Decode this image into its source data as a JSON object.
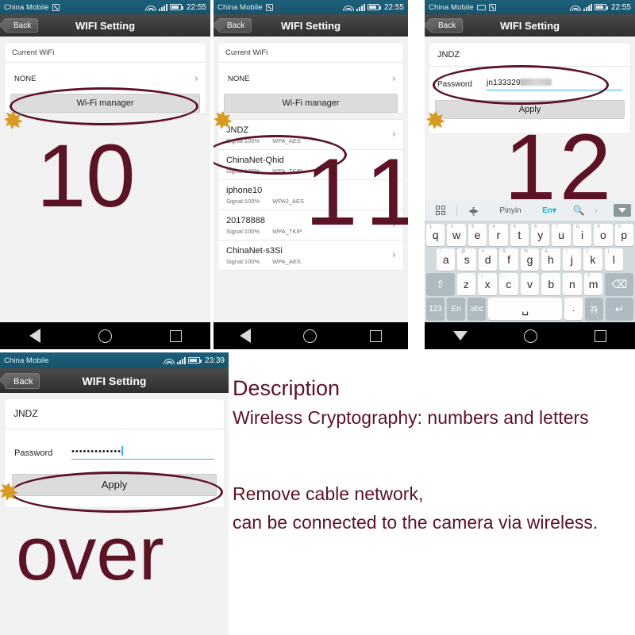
{
  "panels": {
    "p1": {
      "statusbar": {
        "carrier": "China Mobile",
        "time": "22:55",
        "icons": [
          "message-icon",
          "wifi-icon",
          "signal-icon",
          "battery-icon"
        ]
      },
      "titlebar": {
        "back": "Back",
        "title": "WIFI Setting"
      },
      "card": {
        "header": "Current WiFi",
        "value": "NONE",
        "chevron": "›",
        "button": "Wi-Fi manager"
      },
      "step": "10"
    },
    "p2": {
      "statusbar": {
        "carrier": "China Mobile",
        "time": "22:55"
      },
      "titlebar": {
        "back": "Back",
        "title": "WIFI Setting"
      },
      "card": {
        "header": "Current WiFi",
        "value": "NONE",
        "chevron": "›",
        "button": "Wi-Fi manager"
      },
      "networks": [
        {
          "ssid": "JNDZ",
          "signal": "Signal:100%",
          "security": "WPA_AES",
          "chevron": "›"
        },
        {
          "ssid": "ChinaNet-Qhid",
          "signal": "Signal:100%",
          "security": "WPA_TKIP",
          "chevron": "›"
        },
        {
          "ssid": "iphone10",
          "signal": "Signal:100%",
          "security": "WPA2_AES",
          "chevron": "›"
        },
        {
          "ssid": "20178888",
          "signal": "Signal:100%",
          "security": "WPA_TKIP",
          "chevron": "›"
        },
        {
          "ssid": "ChinaNet-s3Si",
          "signal": "Signal:100%",
          "security": "WPA_AES",
          "chevron": "›"
        }
      ],
      "step": "11"
    },
    "p3": {
      "statusbar": {
        "carrier": "China Mobile",
        "time": "22:55"
      },
      "titlebar": {
        "back": "Back",
        "title": "WIFI Setting"
      },
      "form": {
        "ssid": "JNDZ",
        "password_label": "Password",
        "password_value": "jn133329",
        "apply": "Apply"
      },
      "keyboard": {
        "toolbar": {
          "grid_icon": "grid-icon",
          "cursor_icon": "cursor-move-icon",
          "mode": "Pinyin",
          "lang": "En▾",
          "search_icon": "search-icon",
          "more": "›",
          "collapse_icon": "collapse-icon"
        },
        "row1": [
          {
            "k": "q",
            "n": "1"
          },
          {
            "k": "w",
            "n": "2"
          },
          {
            "k": "e",
            "n": "3"
          },
          {
            "k": "r",
            "n": "4"
          },
          {
            "k": "t",
            "n": "5"
          },
          {
            "k": "y",
            "n": "6"
          },
          {
            "k": "u",
            "n": "7"
          },
          {
            "k": "i",
            "n": "8"
          },
          {
            "k": "o",
            "n": "9"
          },
          {
            "k": "p",
            "n": "0"
          }
        ],
        "row2": [
          {
            "k": "a",
            "n": "!"
          },
          {
            "k": "s",
            "n": "@"
          },
          {
            "k": "d",
            "n": "#"
          },
          {
            "k": "f",
            "n": "$"
          },
          {
            "k": "g",
            "n": "%"
          },
          {
            "k": "h",
            "n": "&"
          },
          {
            "k": "j",
            "n": "*"
          },
          {
            "k": "k",
            "n": "("
          },
          {
            "k": "l",
            "n": ")"
          }
        ],
        "row3_shift": "⇧",
        "row3": [
          {
            "k": "z",
            "n": "'"
          },
          {
            "k": "x",
            "n": "/"
          },
          {
            "k": "c",
            "n": "~"
          },
          {
            "k": "v",
            "n": "-"
          },
          {
            "k": "b",
            "n": ":"
          },
          {
            "k": "n",
            "n": ";"
          },
          {
            "k": "m",
            "n": "?"
          }
        ],
        "row3_back": "⌫",
        "row4": [
          "123",
          "En",
          "abc",
          "␣",
          ".",
          "符",
          "↵"
        ]
      },
      "step": "12"
    },
    "p4": {
      "statusbar": {
        "carrier": "China Mobile",
        "time": "23:39"
      },
      "titlebar": {
        "back": "Back",
        "title": "WIFI Setting"
      },
      "form": {
        "ssid": "JNDZ",
        "password_label": "Password",
        "password_value": "•••••••••••••",
        "apply": "Apply"
      },
      "step": "over"
    }
  },
  "description": {
    "title": "Description",
    "line1": "Wireless Cryptography: numbers and letters",
    "line2": "Remove cable network,",
    "line3": "can be connected to the camera via wireless."
  },
  "colors": {
    "annotation": "#5c1326",
    "statusbar": "#1d5f7a",
    "accent_input": "#35b8e0",
    "cursor": "#d79a22"
  },
  "navbar": {
    "back_icon": "nav-back-icon",
    "home_icon": "nav-home-icon",
    "recents_icon": "nav-recents-icon",
    "down_icon": "nav-keyboard-down-icon"
  }
}
